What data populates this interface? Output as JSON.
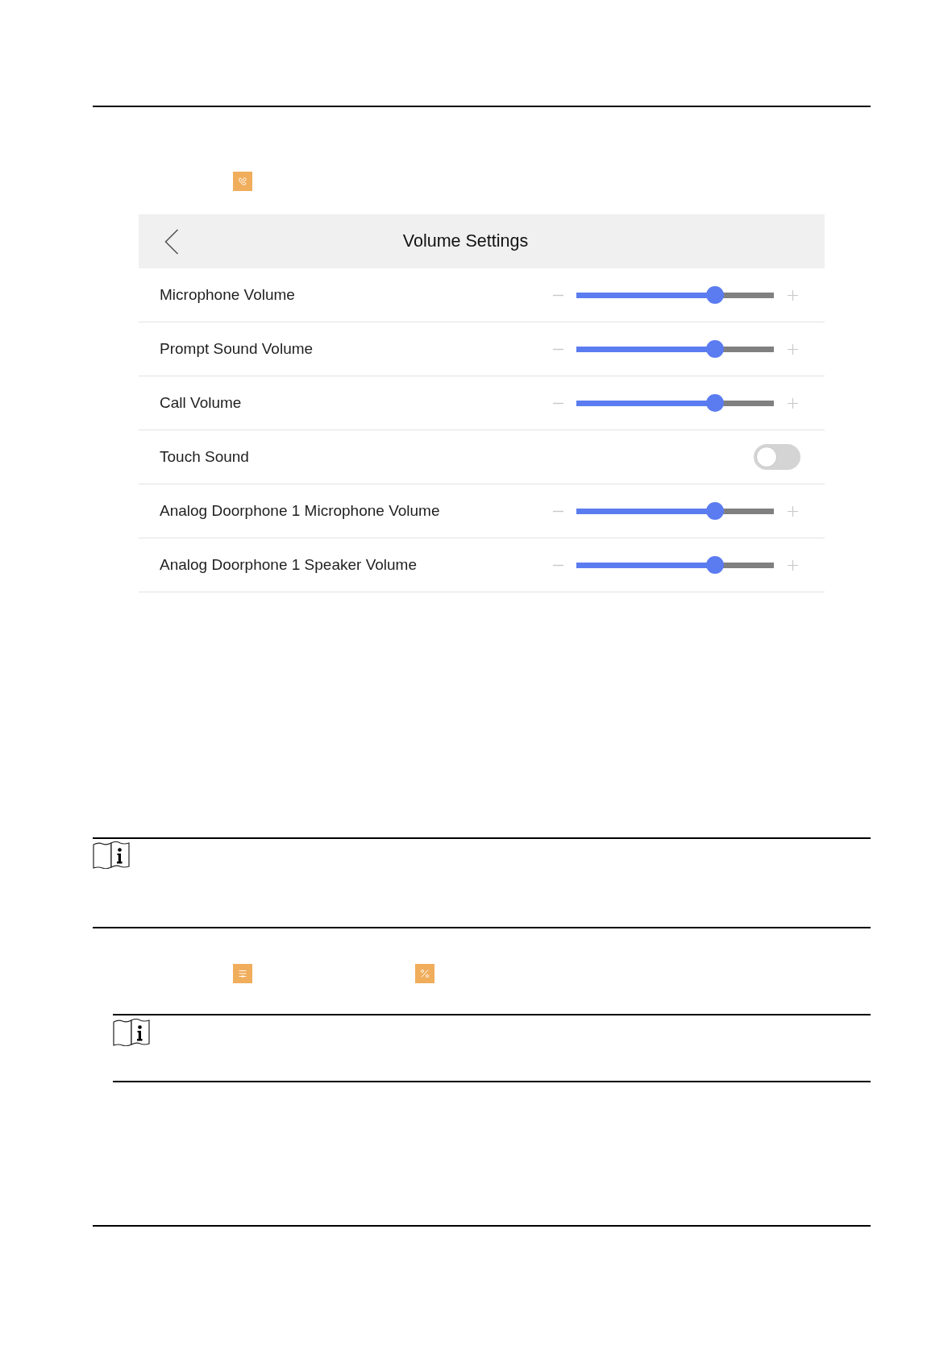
{
  "screen": {
    "title": "Volume Settings",
    "settings": [
      {
        "kind": "slider",
        "label": "Microphone Volume",
        "level": 0.7
      },
      {
        "kind": "slider",
        "label": "Prompt Sound Volume",
        "level": 0.7
      },
      {
        "kind": "slider",
        "label": "Call Volume",
        "level": 0.7
      },
      {
        "kind": "toggle",
        "label": "Touch Sound",
        "on": false
      },
      {
        "kind": "slider",
        "label": "Analog Doorphone 1 Microphone Volume",
        "level": 0.7
      },
      {
        "kind": "slider",
        "label": "Analog Doorphone 1 Speaker Volume",
        "level": 0.7
      }
    ]
  }
}
